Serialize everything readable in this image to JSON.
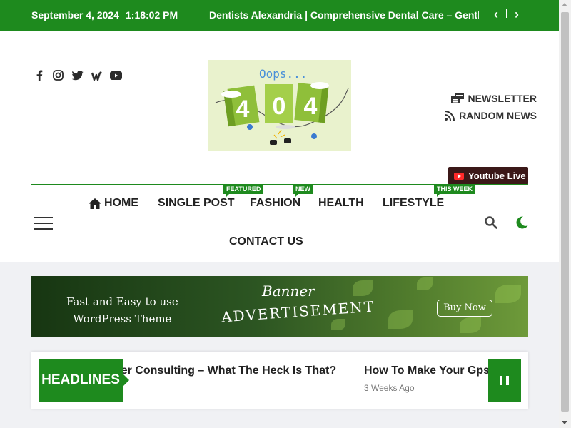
{
  "topbar": {
    "date": "September 4, 2024",
    "time": "1:18:02 PM",
    "ticker": "Dentists Alexandria | Comprehensive Dental Care – Gentle",
    "prev_arrow": "‹",
    "next_arrow": "›"
  },
  "header": {
    "logo_text": "Oops...",
    "logo_number": "404",
    "newsletter_label": "NEWSLETTER",
    "random_news_label": "RANDOM NEWS",
    "youtube_live_label": "Youtube Live"
  },
  "nav": {
    "items": [
      {
        "label": "HOME"
      },
      {
        "label": "SINGLE POST"
      },
      {
        "label": "FASHION"
      },
      {
        "label": "HEALTH"
      },
      {
        "label": "LIFESTYLE"
      },
      {
        "label": "CONTACT US"
      }
    ],
    "tags": {
      "single_post": "FEATURED",
      "fashion": "NEW",
      "lifestyle": "THIS WEEK"
    }
  },
  "banner": {
    "left_line1": "Fast and Easy to use",
    "left_line2": "WordPress Theme",
    "title": "Banner",
    "subtitle": "ADVERTISEMENT",
    "button_label": "Buy Now"
  },
  "headlines": {
    "label": "HEADLINES",
    "items": [
      {
        "title": "her Consulting – What The Heck Is That?",
        "meta": ""
      },
      {
        "title": "How To Make Your Gps J",
        "meta": "3 Weeks Ago"
      }
    ]
  },
  "colors": {
    "accent": "#1e8a1e",
    "youtube_bg": "#3b1818"
  }
}
